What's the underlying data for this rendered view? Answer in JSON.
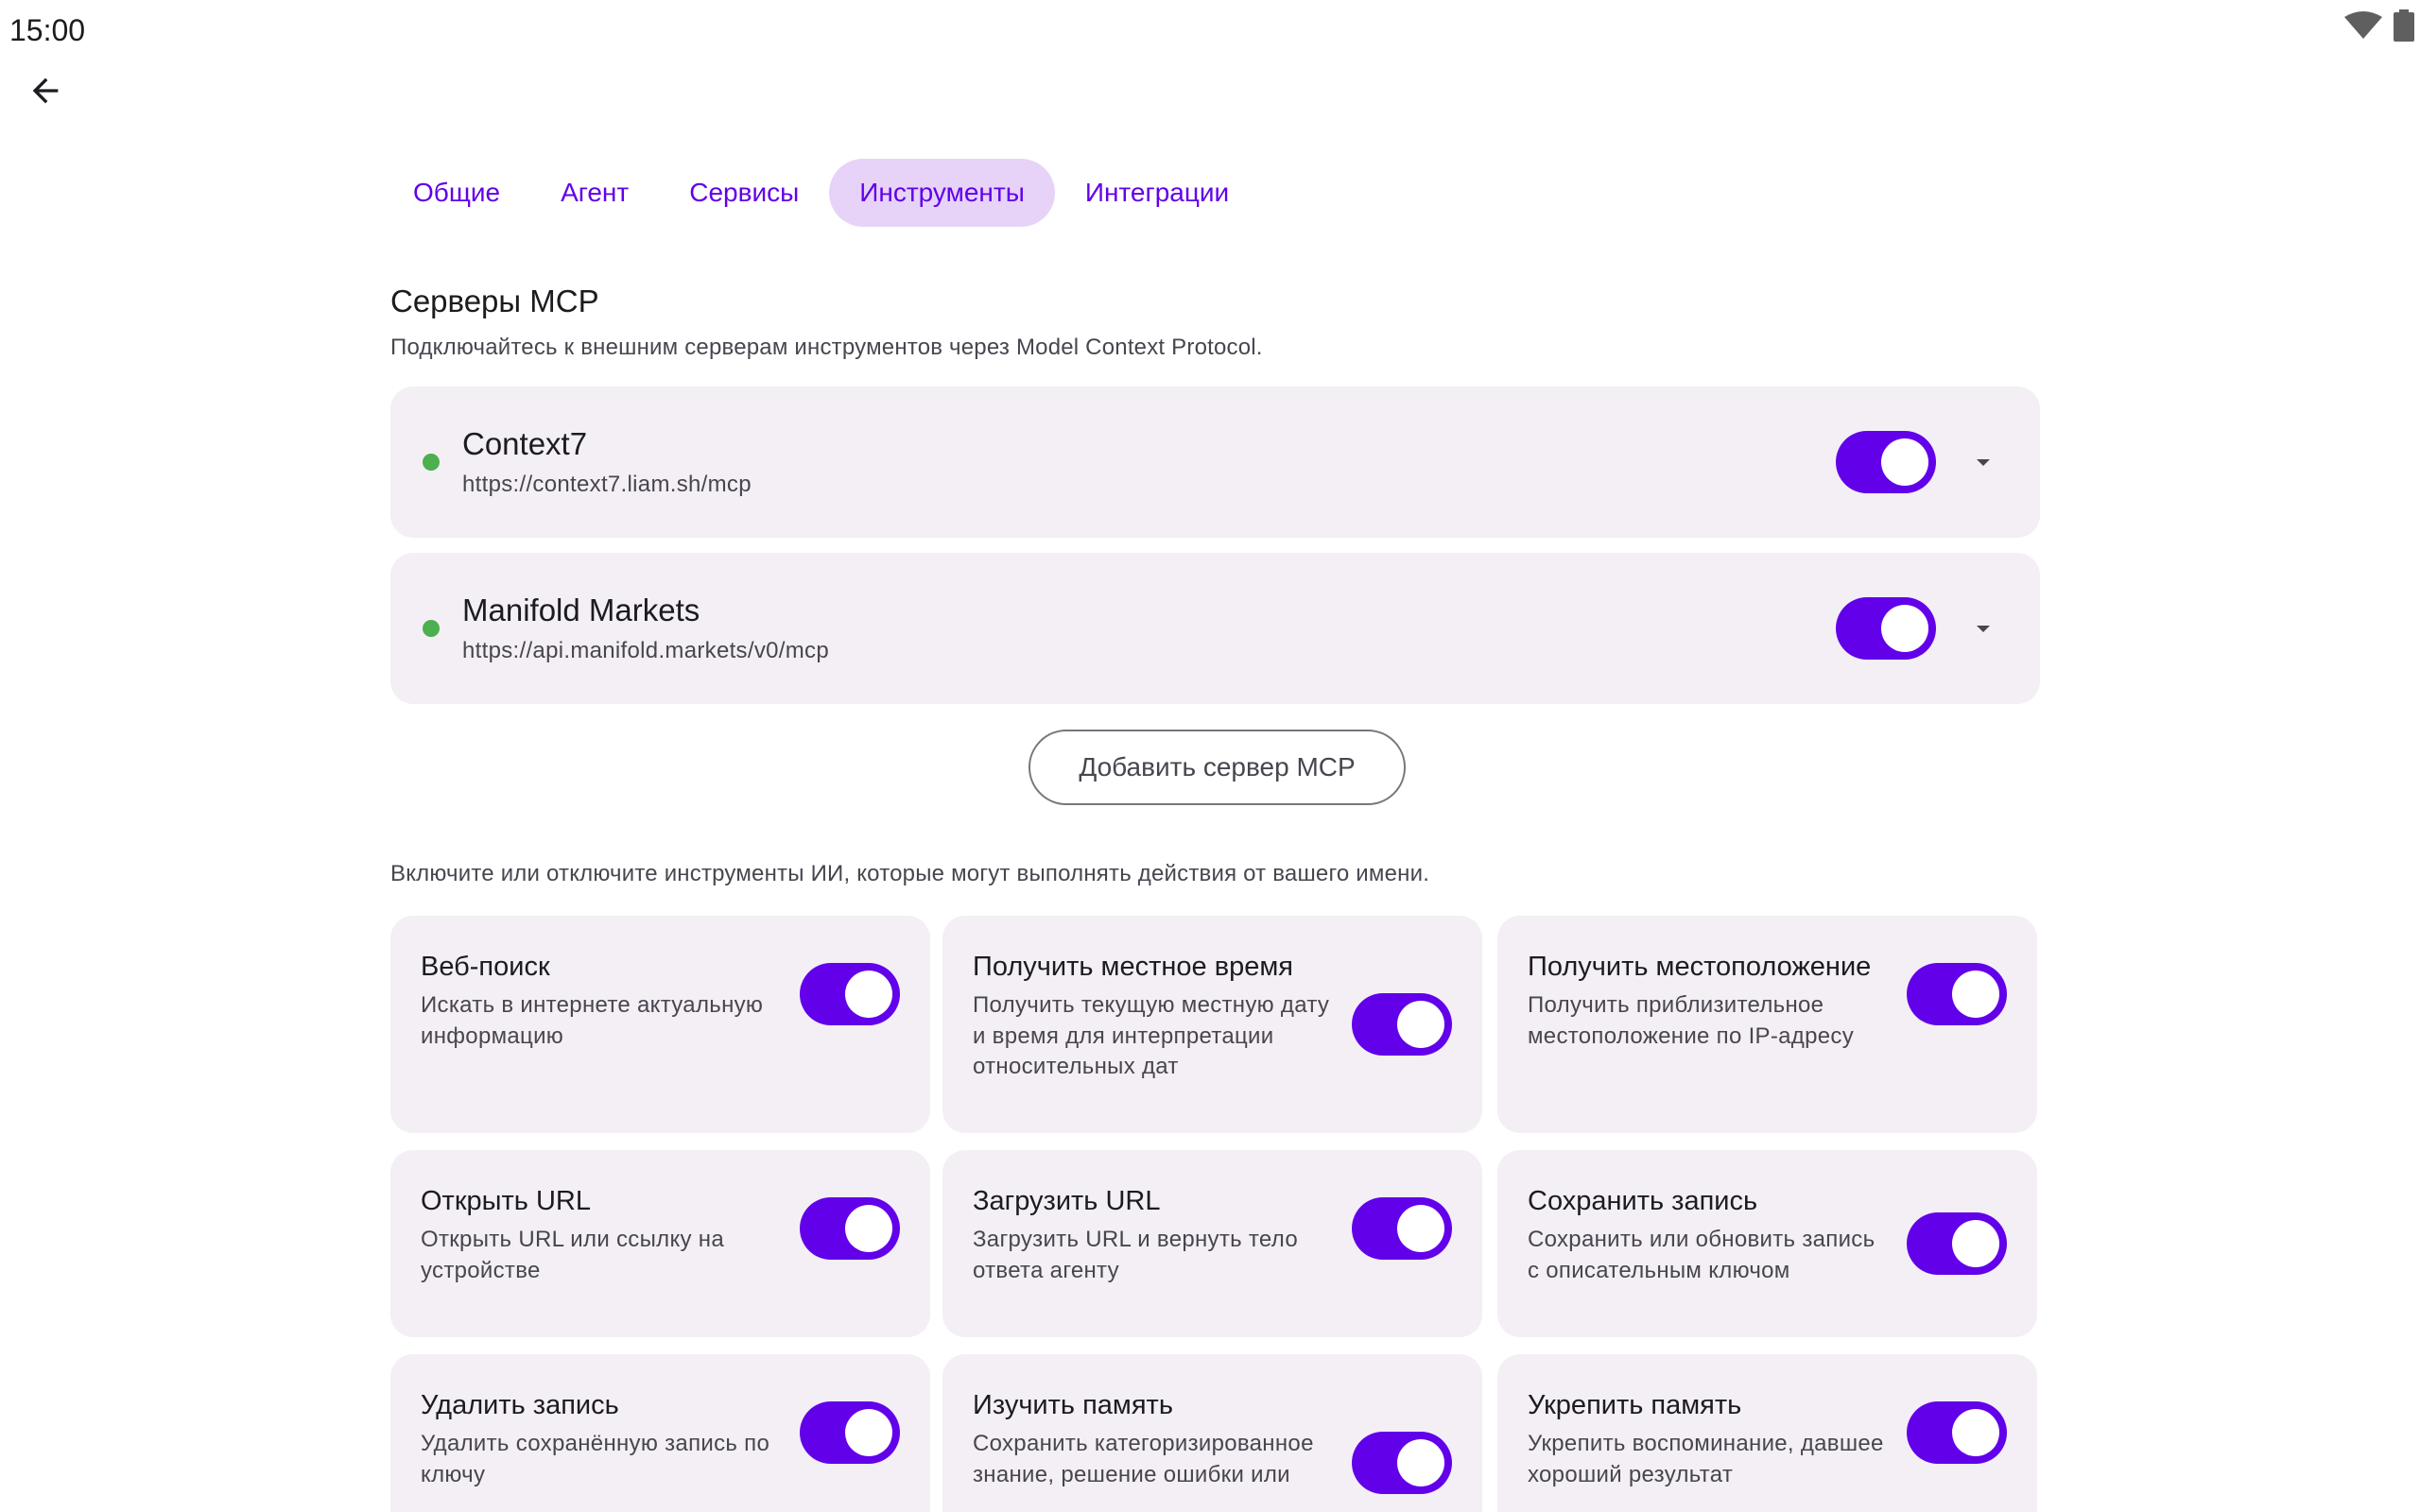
{
  "status": {
    "time": "15:00"
  },
  "tabs": [
    {
      "label": "Общие",
      "active": false
    },
    {
      "label": "Агент",
      "active": false
    },
    {
      "label": "Сервисы",
      "active": false
    },
    {
      "label": "Инструменты",
      "active": true
    },
    {
      "label": "Интеграции",
      "active": false
    }
  ],
  "mcp": {
    "title": "Серверы MCP",
    "description": "Подключайтесь к внешним серверам инструментов через Model Context Protocol.",
    "servers": [
      {
        "name": "Context7",
        "url": "https://context7.liam.sh/mcp",
        "enabled": true,
        "status": "connected"
      },
      {
        "name": "Manifold Markets",
        "url": "https://api.manifold.markets/v0/mcp",
        "enabled": true,
        "status": "connected"
      }
    ],
    "add_button": "Добавить сервер MCP"
  },
  "tools": {
    "description": "Включите или отключите инструменты ИИ, которые могут выполнять действия от вашего имени.",
    "items": [
      {
        "title": "Веб-поиск",
        "desc": "Искать в интернете актуальную информацию",
        "enabled": true
      },
      {
        "title": "Получить местное время",
        "desc": "Получить текущую местную дату и время для интерпретации относительных дат",
        "enabled": true
      },
      {
        "title": "Получить местоположение",
        "desc": "Получить приблизительное местоположение по IP-адресу",
        "enabled": true
      },
      {
        "title": "Открыть URL",
        "desc": "Открыть URL или ссылку на устройстве",
        "enabled": true
      },
      {
        "title": "Загрузить URL",
        "desc": "Загрузить URL и вернуть тело ответа агенту",
        "enabled": true
      },
      {
        "title": "Сохранить запись",
        "desc": "Сохранить или обновить запись с описательным ключом",
        "enabled": true
      },
      {
        "title": "Удалить запись",
        "desc": "Удалить сохранённую запись по ключу",
        "enabled": true
      },
      {
        "title": "Изучить память",
        "desc": "Сохранить категоризированное знание, решение ошибки или",
        "enabled": true
      },
      {
        "title": "Укрепить память",
        "desc": "Укрепить воспоминание, давшее хороший результат",
        "enabled": true
      }
    ]
  },
  "colors": {
    "accent": "#6200ea",
    "card_bg": "#f3eff5",
    "tab_active_bg": "#e6d3f7",
    "status_ok": "#4caf50"
  }
}
